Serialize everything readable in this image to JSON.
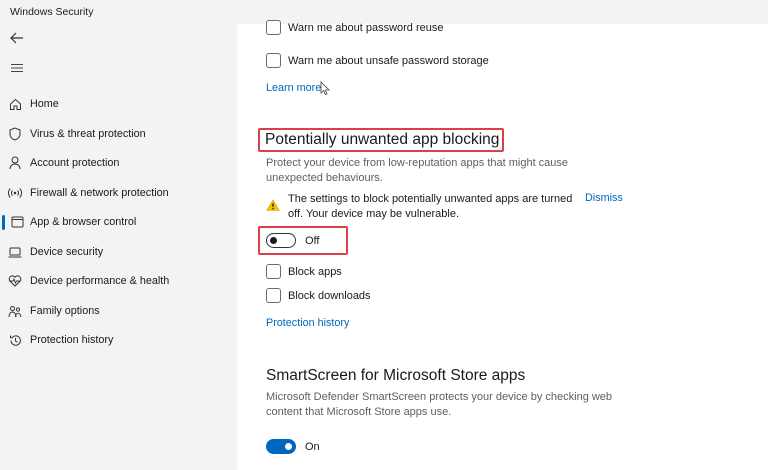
{
  "window": {
    "title": "Windows Security"
  },
  "sidebar": {
    "back_icon": "back-arrow-icon",
    "menu_icon": "hamburger-menu-icon",
    "items": [
      {
        "label": "Home",
        "icon": "home-icon"
      },
      {
        "label": "Virus & threat protection",
        "icon": "shield-icon"
      },
      {
        "label": "Account protection",
        "icon": "person-icon"
      },
      {
        "label": "Firewall & network protection",
        "icon": "wifi-broadcast-icon"
      },
      {
        "label": "App & browser control",
        "icon": "app-window-icon",
        "active": true
      },
      {
        "label": "Device security",
        "icon": "laptop-icon"
      },
      {
        "label": "Device performance & health",
        "icon": "heart-pulse-icon"
      },
      {
        "label": "Family options",
        "icon": "family-icon"
      },
      {
        "label": "Protection history",
        "icon": "history-icon"
      }
    ]
  },
  "main": {
    "reputation": {
      "password_reuse_label": "Warn me about password reuse",
      "password_storage_label": "Warn me about unsafe password storage",
      "learn_more": "Learn more"
    },
    "pua": {
      "title": "Potentially unwanted app blocking",
      "description": "Protect your device from low-reputation apps that might cause unexpected behaviours.",
      "warning_text": "The settings to block potentially unwanted apps are turned off. Your device may be vulnerable.",
      "dismiss": "Dismiss",
      "toggle_state": "Off",
      "block_apps_label": "Block apps",
      "block_downloads_label": "Block downloads",
      "protection_history_link": "Protection history"
    },
    "smartscreen_store": {
      "title": "SmartScreen for Microsoft Store apps",
      "description": "Microsoft Defender SmartScreen protects your device by checking web content that Microsoft Store apps use.",
      "toggle_state": "On"
    }
  },
  "colors": {
    "accent": "#0067c0",
    "highlight_border": "#d9404a",
    "warning": "#f2c200",
    "sidebar_bg": "#f3f3f3"
  }
}
